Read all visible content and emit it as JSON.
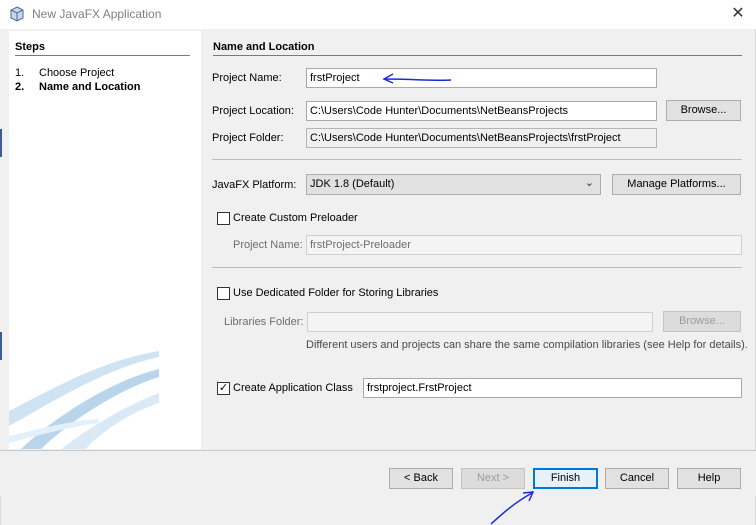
{
  "window": {
    "title": "New JavaFX Application",
    "close_glyph": "✕",
    "accent_color": "#0078d7"
  },
  "steps": {
    "title": "Steps",
    "items": [
      {
        "num": "1.",
        "label": "Choose Project",
        "current": false
      },
      {
        "num": "2.",
        "label": "Name and Location",
        "current": true
      }
    ]
  },
  "panel": {
    "title": "Name and Location",
    "project_name": {
      "label": "Project Name:",
      "value": "frstProject"
    },
    "project_location": {
      "label": "Project Location:",
      "value": "C:\\Users\\Code Hunter\\Documents\\NetBeansProjects"
    },
    "project_folder": {
      "label": "Project Folder:",
      "value": "C:\\Users\\Code Hunter\\Documents\\NetBeansProjects\\frstProject"
    },
    "browse_label": "Browse...",
    "platform": {
      "label": "JavaFX Platform:",
      "value": "JDK 1.8 (Default)",
      "arrow": "⌄"
    },
    "manage_platforms_label": "Manage Platforms...",
    "custom_preloader": {
      "label": "Create Custom Preloader",
      "checked": false
    },
    "preloader_project": {
      "label": "Project Name:",
      "value": "frstProject-Preloader"
    },
    "dedicated_folder": {
      "label": "Use Dedicated Folder for Storing Libraries",
      "checked": false
    },
    "libraries_folder": {
      "label": "Libraries Folder:",
      "value": ""
    },
    "libraries_browse_label": "Browse...",
    "libraries_hint": "Different users and projects can share the same compilation libraries (see Help for details).",
    "app_class": {
      "label": "Create Application Class",
      "checked": true,
      "value": "frstproject.FrstProject",
      "check_glyph": "✓"
    }
  },
  "footer": {
    "back_label": "< Back",
    "next_label": "Next >",
    "finish_label": "Finish",
    "cancel_label": "Cancel",
    "help_label": "Help"
  },
  "annotations": {
    "arrow_color": "#1a2bd6"
  }
}
